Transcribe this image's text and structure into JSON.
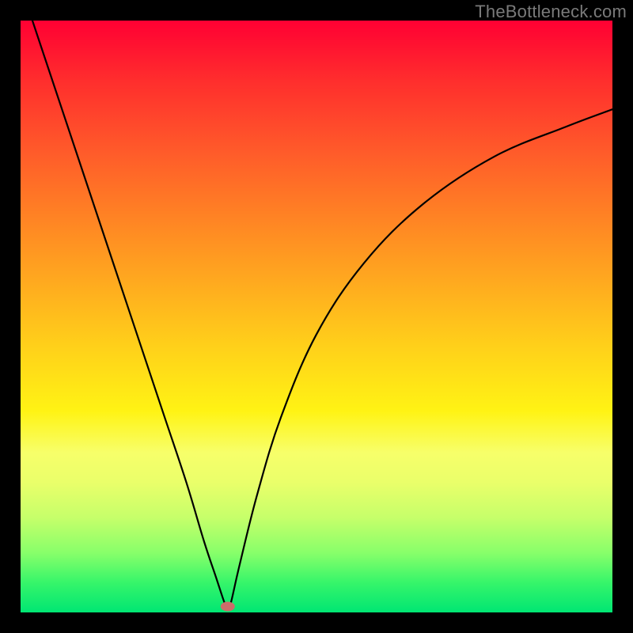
{
  "watermark": "TheBottleneck.com",
  "chart_data": {
    "type": "line",
    "title": "",
    "xlabel": "",
    "ylabel": "",
    "xlim": [
      0,
      100
    ],
    "ylim": [
      0,
      100
    ],
    "grid": false,
    "legend": false,
    "series": [
      {
        "name": "bottleneck-curve",
        "x": [
          2,
          6,
          12,
          18,
          24,
          28,
          31,
          33,
          34.5,
          35,
          35.5,
          37,
          40,
          44,
          50,
          58,
          68,
          80,
          92,
          100
        ],
        "y": [
          100,
          88,
          70,
          52,
          34,
          22,
          12,
          6,
          1.5,
          0.8,
          1.5,
          8,
          20,
          33,
          47,
          59,
          69,
          77,
          82,
          85
        ]
      }
    ],
    "annotations": [
      {
        "name": "min-marker",
        "x": 35,
        "y": 1,
        "color": "#cc6d6a"
      }
    ],
    "background_gradient_stops": [
      {
        "pos": 0,
        "color": "#ff0033"
      },
      {
        "pos": 50,
        "color": "#ffc81a"
      },
      {
        "pos": 75,
        "color": "#f7ff6a"
      },
      {
        "pos": 100,
        "color": "#00e673"
      }
    ]
  }
}
